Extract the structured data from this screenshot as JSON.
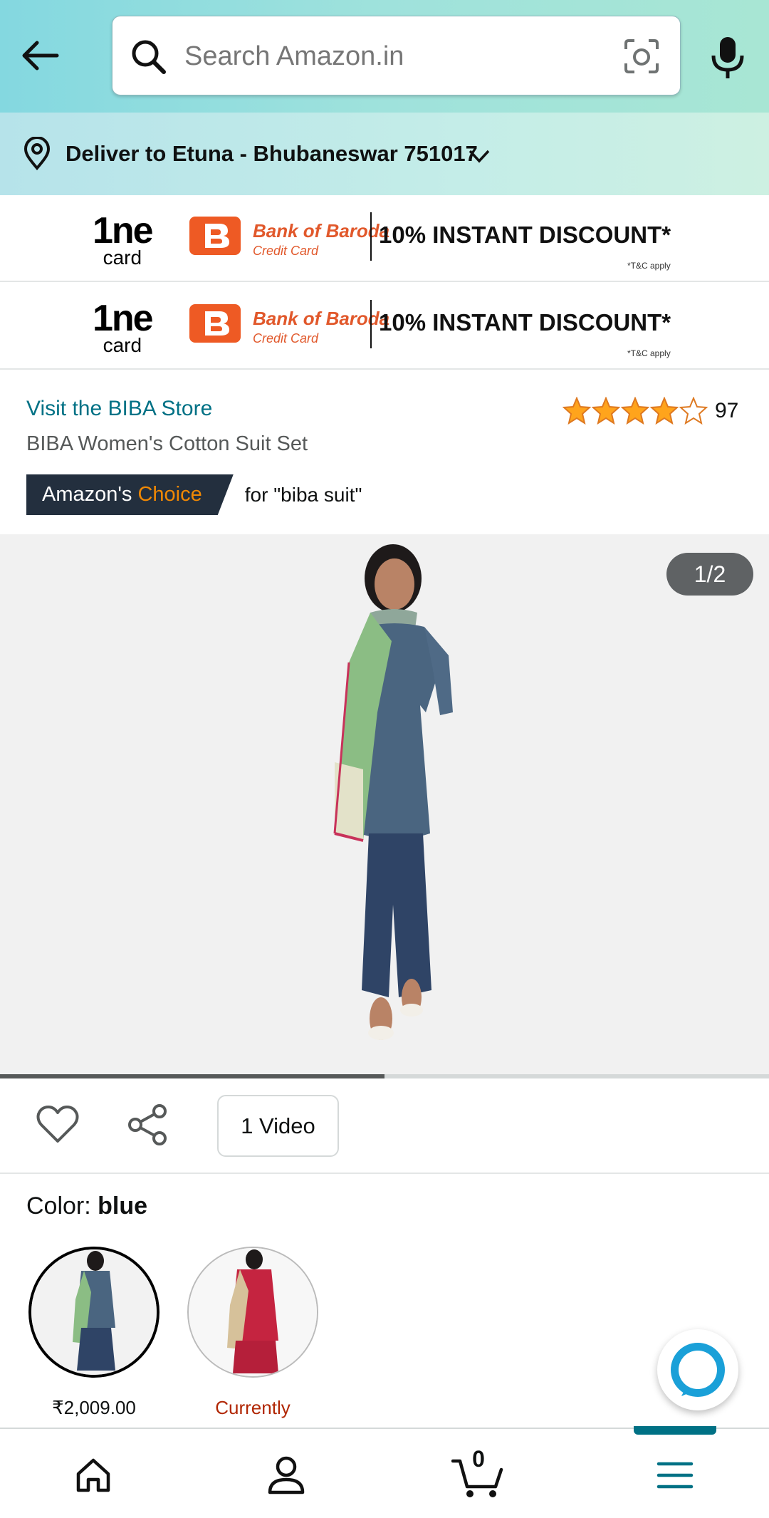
{
  "header": {
    "search_placeholder": "Search Amazon.in"
  },
  "delivery": {
    "text": "Deliver to Etuna - Bhubaneswar 751017"
  },
  "promos": [
    {
      "brand_big": "1ne",
      "brand_small": "card",
      "bank_name": "Bank of Baroda",
      "bank_sub": "Credit Card",
      "discount": "10% INSTANT DISCOUNT*",
      "tc": "*T&C apply"
    },
    {
      "brand_big": "1ne",
      "brand_small": "card",
      "bank_name": "Bank of Baroda",
      "bank_sub": "Credit Card",
      "discount": "10% INSTANT DISCOUNT*",
      "tc": "*T&C apply"
    }
  ],
  "product": {
    "store_link": "Visit the BIBA Store",
    "title": "BIBA Women's Cotton Suit Set",
    "rating": 4.0,
    "rating_count": "97",
    "choice_prefix": "Amazon's",
    "choice_word": "Choice",
    "choice_for": "for \"biba suit\""
  },
  "gallery": {
    "pager": "1/2",
    "progress": 0.5
  },
  "actions": {
    "video_label": "1 Video"
  },
  "color": {
    "label": "Color:",
    "value": "blue",
    "swatches": [
      {
        "caption": "₹2,009.00",
        "selected": true
      },
      {
        "caption": "Currently",
        "selected": false
      }
    ]
  },
  "bottom_nav": {
    "cart_count": "0",
    "items": [
      "home-icon",
      "account-icon",
      "cart-icon",
      "menu-icon"
    ]
  },
  "colors": {
    "accent": "#007185",
    "badge": "#232f3e",
    "badge_highlight": "#f08804",
    "star": "#ffa41c",
    "status_red": "#b12704"
  }
}
